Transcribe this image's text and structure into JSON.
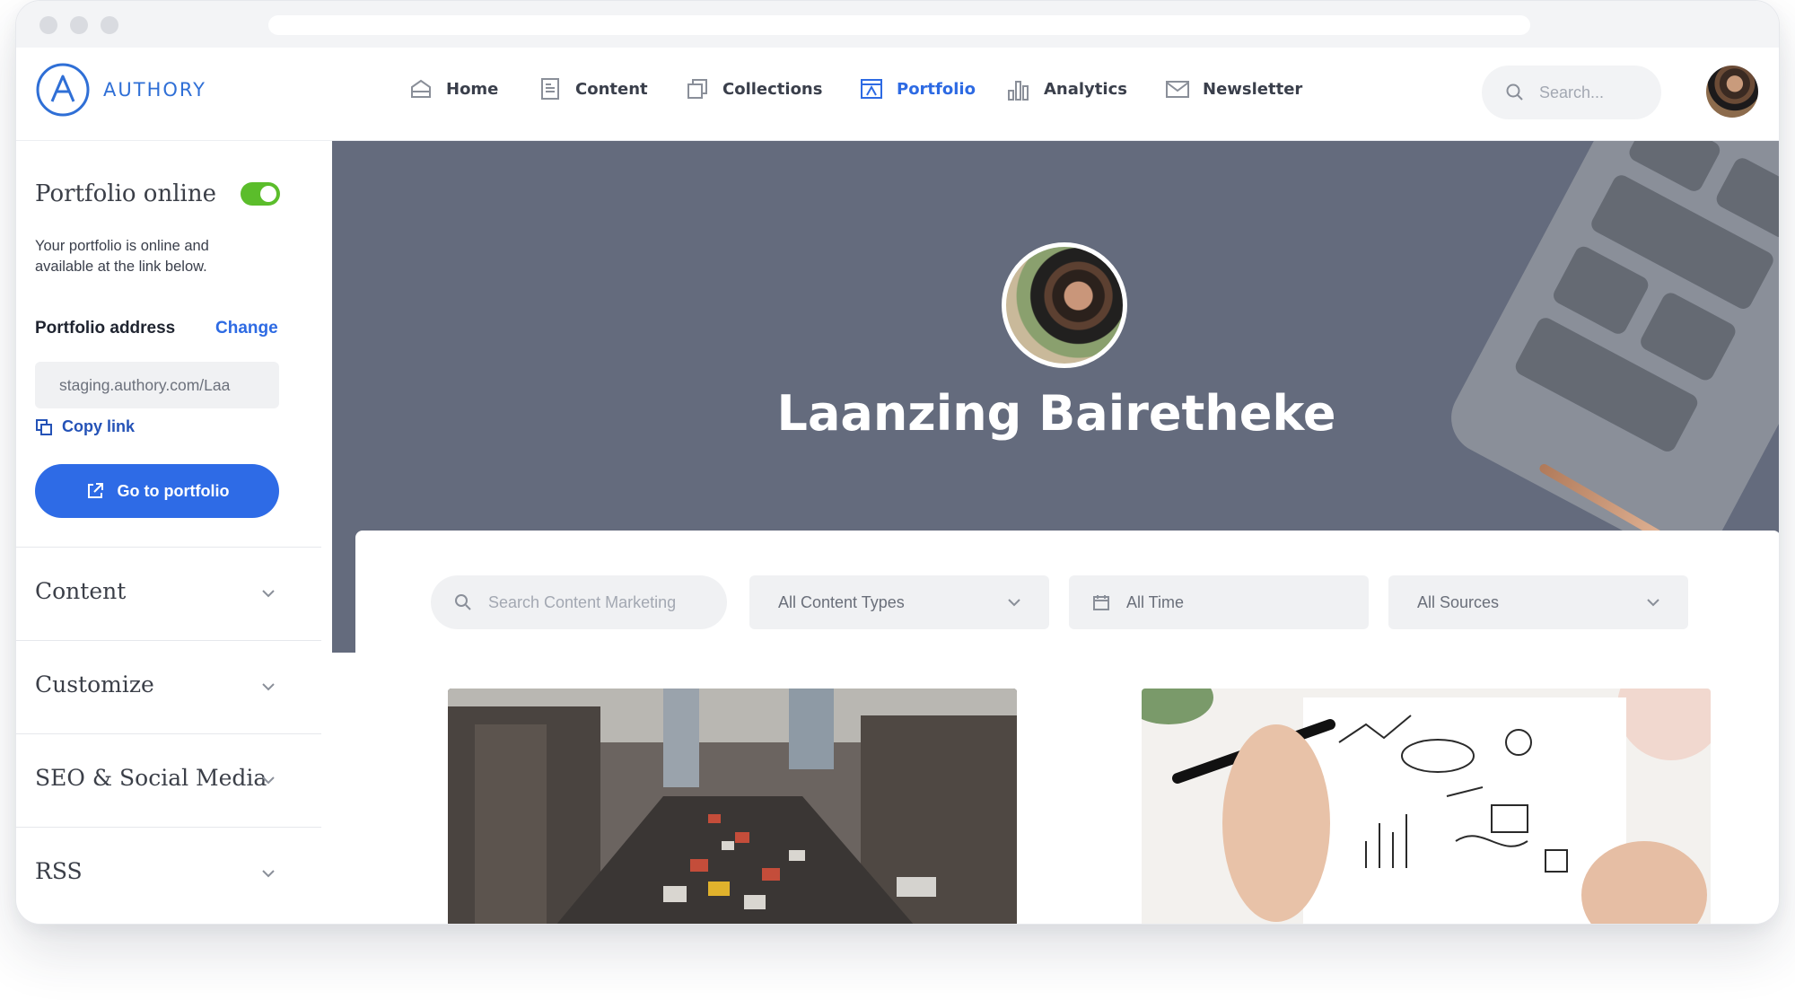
{
  "brand": {
    "name": "AUTHORY",
    "accent": "#2d6ae3"
  },
  "nav": {
    "items": [
      {
        "label": "Home",
        "icon": "home-icon"
      },
      {
        "label": "Content",
        "icon": "content-icon"
      },
      {
        "label": "Collections",
        "icon": "collections-icon"
      },
      {
        "label": "Portfolio",
        "icon": "portfolio-icon",
        "active": true
      },
      {
        "label": "Analytics",
        "icon": "analytics-icon"
      },
      {
        "label": "Newsletter",
        "icon": "newsletter-icon"
      }
    ],
    "search_placeholder": "Search..."
  },
  "sidebar": {
    "title": "Portfolio online",
    "toggle_on": true,
    "description": "Your portfolio is online and available at the link below.",
    "address_label": "Portfolio address",
    "change_label": "Change",
    "address_value": "staging.authory.com/Laa",
    "copy_label": "Copy link",
    "go_label": "Go to portfolio",
    "sections": [
      {
        "label": "Content"
      },
      {
        "label": "Customize"
      },
      {
        "label": "SEO & Social Media"
      },
      {
        "label": "RSS"
      }
    ]
  },
  "portfolio": {
    "name": "Laanzing Bairetheke",
    "filters": {
      "search_placeholder": "Search Content Marketing",
      "content_types": "All Content Types",
      "time": "All Time",
      "sources": "All Sources"
    },
    "cards": [
      {
        "image": "city-traffic-photo"
      },
      {
        "image": "business-sketch-photo"
      }
    ]
  },
  "colors": {
    "toggle": "#5bbd2b",
    "primary_button": "#2e6be6",
    "hero_bg": "#646b7d"
  }
}
